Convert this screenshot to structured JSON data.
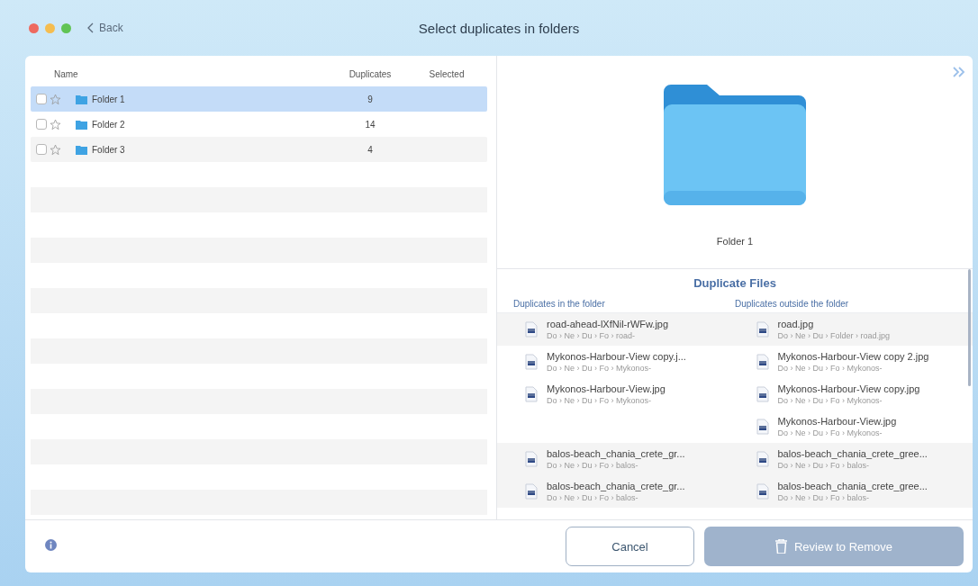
{
  "window": {
    "title": "Select duplicates in folders",
    "back": "Back"
  },
  "table": {
    "columns": [
      "Name",
      "Duplicates",
      "Selected"
    ],
    "rows": [
      {
        "name": "Folder 1",
        "duplicates": "9",
        "checked": false,
        "starred": false,
        "selected": true
      },
      {
        "name": "Folder 2",
        "duplicates": "14",
        "checked": false,
        "starred": false,
        "selected": false
      },
      {
        "name": "Folder 3",
        "duplicates": "4",
        "checked": false,
        "starred": false,
        "selected": false
      }
    ]
  },
  "preview": {
    "name": "Folder 1"
  },
  "duplicates": {
    "title": "Duplicate Files",
    "column_in": "Duplicates in the folder",
    "column_out": "Duplicates outside the folder",
    "groups": [
      {
        "inside": [
          {
            "name": "road-ahead-lXfNil-rWFw.jpg",
            "path": "Do › Ne › Du › Fo › road-"
          }
        ],
        "outside": [
          {
            "name": "road.jpg",
            "path": "Do › Ne › Du › Folder › road.jpg"
          }
        ]
      },
      {
        "inside": [
          {
            "name": "Mykonos-Harbour-View copy.j...",
            "path": "Do › Ne › Du › Fo › Mykonos-"
          },
          {
            "name": "Mykonos-Harbour-View.jpg",
            "path": "Do › Ne › Du › Fo › Mykonos-"
          }
        ],
        "outside": [
          {
            "name": "Mykonos-Harbour-View copy 2.jpg",
            "path": "Do › Ne › Du › Fo › Mykonos-"
          },
          {
            "name": "Mykonos-Harbour-View copy.jpg",
            "path": "Do › Ne › Du › Fo › Mykonos-"
          },
          {
            "name": "Mykonos-Harbour-View.jpg",
            "path": "Do › Ne › Du › Fo › Mykonos-"
          }
        ]
      },
      {
        "inside": [
          {
            "name": "balos-beach_chania_crete_gr...",
            "path": "Do › Ne › Du › Fo › balos-"
          },
          {
            "name": "balos-beach_chania_crete_gr...",
            "path": "Do › Ne › Du › Fo › balos-"
          }
        ],
        "outside": [
          {
            "name": "balos-beach_chania_crete_gree...",
            "path": "Do › Ne › Du › Fo › balos-"
          },
          {
            "name": "balos-beach_chania_crete_gree...",
            "path": "Do › Ne › Du › Fo › balos-"
          }
        ]
      }
    ]
  },
  "buttons": [
    {
      "label": "Cancel",
      "disabled": false
    },
    {
      "label": "Review to Remove",
      "disabled": true
    }
  ]
}
